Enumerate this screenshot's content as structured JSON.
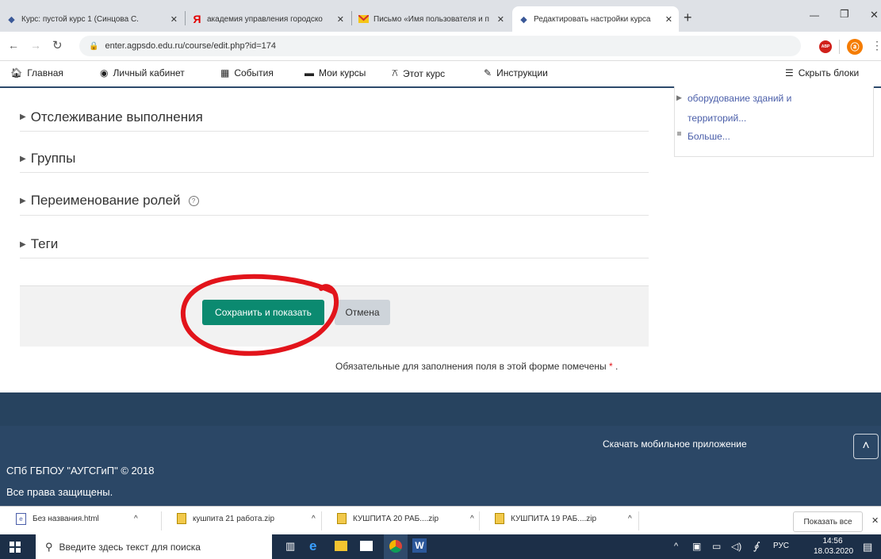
{
  "browser": {
    "tabs": [
      {
        "label": "Курс: пустой курс 1 (Синцова С.",
        "close": "✕"
      },
      {
        "label": "академия управления городско",
        "close": "✕"
      },
      {
        "label": "Письмо «Имя пользователя и п",
        "close": "✕"
      },
      {
        "label": "Редактировать настройки курса",
        "close": "✕"
      }
    ],
    "new_tab": "+",
    "url": "enter.agpsdo.edu.ru/course/edit.php?id=174",
    "window": {
      "minimize": "—",
      "maximize": "❐",
      "close": "✕"
    },
    "abp_badge": "ABP"
  },
  "navbar": {
    "items": [
      {
        "icon": "home-icon",
        "label": "Главная"
      },
      {
        "icon": "dashboard-icon",
        "label": "Личный кабинет"
      },
      {
        "icon": "calendar-icon",
        "label": "События"
      },
      {
        "icon": "briefcase-icon",
        "label": "Мои курсы"
      },
      {
        "icon": "sitemap-icon",
        "label": "Этот курс"
      },
      {
        "icon": "wrench-icon",
        "label": "Инструкции"
      }
    ],
    "hide_blocks": "Скрыть блоки"
  },
  "form": {
    "sections": [
      {
        "label": "Отслеживание выполнения"
      },
      {
        "label": "Группы"
      },
      {
        "label": "Переименование ролей",
        "help": "?"
      },
      {
        "label": "Теги"
      }
    ],
    "save_label": "Сохранить и показать",
    "cancel_label": "Отмена",
    "required_note": "Обязательные для заполнения поля в этой форме помечены",
    "required_mark": "*",
    "required_end": ".",
    "annotation_color": "#e2141b"
  },
  "sideblock": {
    "item1_line1": "оборудование зданий и",
    "item1_line2": "территорий...",
    "more": "Больше..."
  },
  "footer": {
    "mobile_app": "Скачать мобильное приложение",
    "copyright": "СПб ГБПОУ \"АУГСГиП\" © 2018",
    "rights": "Все права защищены.",
    "scroll_top": "˄"
  },
  "downloads": {
    "items": [
      {
        "label": "Без названия.html"
      },
      {
        "label": "кушпита 21 работа.zip"
      },
      {
        "label": "КУШПИТА 20 РАБ....zip"
      },
      {
        "label": "КУШПИТА 19 РАБ....zip"
      }
    ],
    "show_all": "Показать все",
    "close": "✕",
    "chevron": "^"
  },
  "taskbar": {
    "search_placeholder": "Введите здесь текст для поиска",
    "lang": "РУС",
    "time": "14:56",
    "date": "18.03.2020"
  }
}
